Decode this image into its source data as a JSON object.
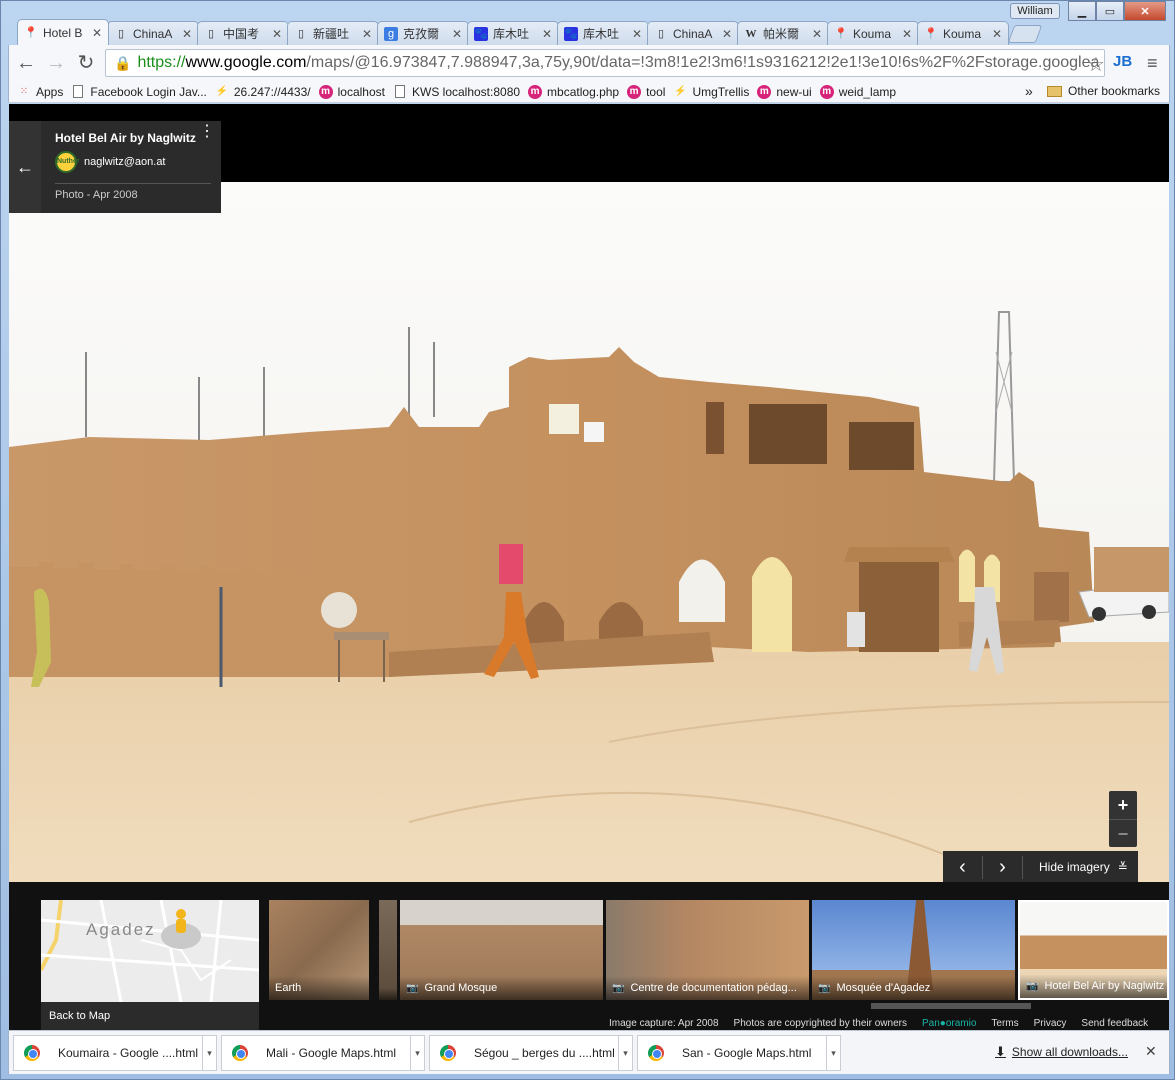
{
  "window": {
    "user": "William"
  },
  "tabs": [
    {
      "label": "Hotel B",
      "icon": "google-maps-icon",
      "active": true
    },
    {
      "label": "ChinaA",
      "icon": "page-icon"
    },
    {
      "label": "中国考",
      "icon": "page-icon"
    },
    {
      "label": "新疆吐",
      "icon": "page-icon"
    },
    {
      "label": "克孜爾",
      "icon": "google-icon"
    },
    {
      "label": "库木吐",
      "icon": "baidu-icon"
    },
    {
      "label": "库木吐",
      "icon": "baidu-icon"
    },
    {
      "label": "ChinaA",
      "icon": "page-icon"
    },
    {
      "label": "帕米爾",
      "icon": "wikipedia-icon"
    },
    {
      "label": "Kouma",
      "icon": "google-maps-icon"
    },
    {
      "label": "Kouma",
      "icon": "google-maps-icon"
    }
  ],
  "address": {
    "scheme": "https://",
    "host": "www.google.com",
    "path": "/maps/@16.973847,7.988947,3a,75y,90t/data=!3m8!1e2!3m6!1s9316212!2e1!3e10!6s%2F%2Fstorage.googlea"
  },
  "bookmarks": [
    {
      "label": "Apps",
      "icon": "apps-grid-icon"
    },
    {
      "label": "Facebook Login Jav...",
      "icon": "page-icon"
    },
    {
      "label": "26.247://4433/",
      "icon": "link-icon"
    },
    {
      "label": "localhost",
      "icon": "magento-icon"
    },
    {
      "label": "KWS localhost:8080",
      "icon": "page-icon"
    },
    {
      "label": "mbcatlog.php",
      "icon": "magento-icon"
    },
    {
      "label": "tool",
      "icon": "magento-icon"
    },
    {
      "label": "UmgTrellis",
      "icon": "link-icon"
    },
    {
      "label": "new-ui",
      "icon": "magento-icon"
    },
    {
      "label": "weid_lamp",
      "icon": "magento-icon"
    }
  ],
  "bookmarks_more": "»",
  "other_bookmarks": "Other bookmarks",
  "photo_info": {
    "title": "Hotel Bel Air by Naglwitz",
    "author_email": "naglwitz@aon.at",
    "avatar_text": "Nuther",
    "date": "Photo - Apr 2008"
  },
  "zoom": {
    "plus": "+",
    "minus": "−"
  },
  "imagery": {
    "prev": "‹",
    "next": "›",
    "hide_label": "Hide imagery",
    "chevron": "≚"
  },
  "minimap": {
    "city": "Agadez",
    "back_label": "Back to Map"
  },
  "thumbnails": [
    {
      "caption": "Earth",
      "has_camera": false
    },
    {
      "caption": "",
      "has_camera": false
    },
    {
      "caption": "Grand Mosque",
      "has_camera": true
    },
    {
      "caption": "Centre de documentation pédag...",
      "has_camera": true
    },
    {
      "caption": "Mosquée d'Agadez",
      "has_camera": true
    },
    {
      "caption": "Hotel Bel Air by Naglwitz",
      "has_camera": true
    }
  ],
  "footer": {
    "capture": "Image capture: Apr 2008",
    "copyright": "Photos are copyrighted by their owners",
    "panoramio_a": "Pan",
    "panoramio_b": "oramio",
    "terms": "Terms",
    "privacy": "Privacy",
    "feedback": "Send feedback"
  },
  "downloads": [
    {
      "label": "Koumaira - Google ....html"
    },
    {
      "label": "Mali - Google Maps.html"
    },
    {
      "label": "Ségou _ berges du ....html"
    },
    {
      "label": "San - Google Maps.html"
    }
  ],
  "show_all_downloads": "Show all downloads..."
}
